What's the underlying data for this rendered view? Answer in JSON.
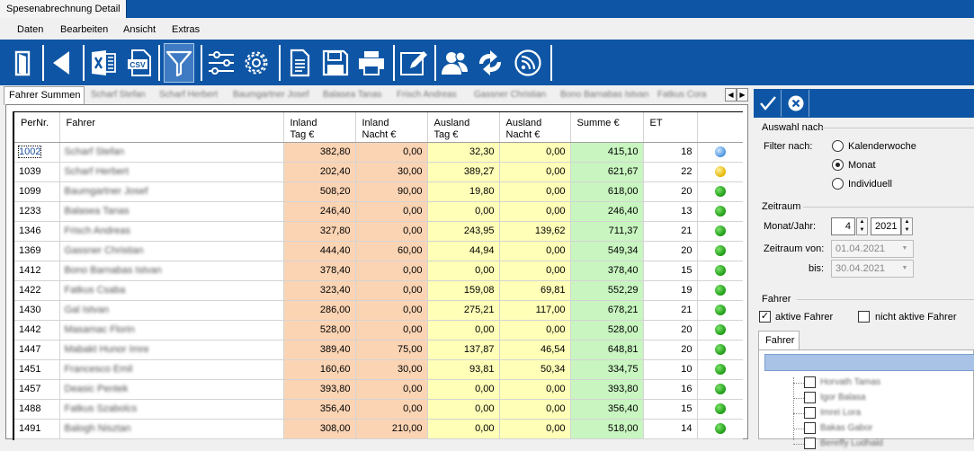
{
  "window": {
    "tab_title": "Spesenabrechnung Detail"
  },
  "menu": [
    "Daten",
    "Bearbeiten",
    "Ansicht",
    "Extras"
  ],
  "toolbar": {
    "icons": [
      "exit-door-icon",
      "back-arrow-icon",
      "excel-export-icon",
      "csv-export-icon",
      "filter-icon",
      "settings-sliders-icon",
      "gear-icon",
      "document-icon",
      "save-disk-icon",
      "print-icon",
      "edit-pencil-icon",
      "users-icon",
      "sync-arrows-icon",
      "rss-feed-icon"
    ],
    "csv_text": "CSV"
  },
  "tabs": {
    "active": "Fahrer Summen",
    "others": [
      "Scharf Stefan",
      "Scharf Herbert",
      "Baumgartner Josef",
      "Balasea Tanas",
      "Frisch Andreas",
      "Gassner Christian",
      "Bono Barnabas Istvan",
      "Fatkus Cora"
    ]
  },
  "grid": {
    "headers": {
      "pernr": "PerNr.",
      "fahrer": "Fahrer",
      "inland_tag": [
        "Inland",
        "Tag €"
      ],
      "inland_nacht": [
        "Inland",
        "Nacht €"
      ],
      "ausland_tag": [
        "Ausland",
        "Tag €"
      ],
      "ausland_nacht": [
        "Ausland",
        "Nacht €"
      ],
      "summe": "Summe €",
      "et": "ET"
    },
    "rows": [
      {
        "pernr": "1002",
        "fahrer": "Scharf Stefan",
        "it": "382,80",
        "in": "0,00",
        "at": "32,30",
        "an": "0,00",
        "sum": "415,10",
        "et": "18",
        "status": "blue"
      },
      {
        "pernr": "1039",
        "fahrer": "Scharf Herbert",
        "it": "202,40",
        "in": "30,00",
        "at": "389,27",
        "an": "0,00",
        "sum": "621,67",
        "et": "22",
        "status": "yellow"
      },
      {
        "pernr": "1099",
        "fahrer": "Baumgartner Josef",
        "it": "508,20",
        "in": "90,00",
        "at": "19,80",
        "an": "0,00",
        "sum": "618,00",
        "et": "20",
        "status": "green"
      },
      {
        "pernr": "1233",
        "fahrer": "Balasea Tanas",
        "it": "246,40",
        "in": "0,00",
        "at": "0,00",
        "an": "0,00",
        "sum": "246,40",
        "et": "13",
        "status": "green"
      },
      {
        "pernr": "1346",
        "fahrer": "Frisch Andreas",
        "it": "327,80",
        "in": "0,00",
        "at": "243,95",
        "an": "139,62",
        "sum": "711,37",
        "et": "21",
        "status": "green"
      },
      {
        "pernr": "1369",
        "fahrer": "Gassner Christian",
        "it": "444,40",
        "in": "60,00",
        "at": "44,94",
        "an": "0,00",
        "sum": "549,34",
        "et": "20",
        "status": "green"
      },
      {
        "pernr": "1412",
        "fahrer": "Bono Barnabas Istvan",
        "it": "378,40",
        "in": "0,00",
        "at": "0,00",
        "an": "0,00",
        "sum": "378,40",
        "et": "15",
        "status": "green"
      },
      {
        "pernr": "1422",
        "fahrer": "Fatkus Csaba",
        "it": "323,40",
        "in": "0,00",
        "at": "159,08",
        "an": "69,81",
        "sum": "552,29",
        "et": "19",
        "status": "green"
      },
      {
        "pernr": "1430",
        "fahrer": "Gal Istvan",
        "it": "286,00",
        "in": "0,00",
        "at": "275,21",
        "an": "117,00",
        "sum": "678,21",
        "et": "21",
        "status": "green"
      },
      {
        "pernr": "1442",
        "fahrer": "Masamac Florin",
        "it": "528,00",
        "in": "0,00",
        "at": "0,00",
        "an": "0,00",
        "sum": "528,00",
        "et": "20",
        "status": "green"
      },
      {
        "pernr": "1447",
        "fahrer": "Mabakt Hunor Imre",
        "it": "389,40",
        "in": "75,00",
        "at": "137,87",
        "an": "46,54",
        "sum": "648,81",
        "et": "20",
        "status": "green"
      },
      {
        "pernr": "1451",
        "fahrer": "Francesco Emil",
        "it": "160,60",
        "in": "30,00",
        "at": "93,81",
        "an": "50,34",
        "sum": "334,75",
        "et": "10",
        "status": "green"
      },
      {
        "pernr": "1457",
        "fahrer": "Deasic Pentek",
        "it": "393,80",
        "in": "0,00",
        "at": "0,00",
        "an": "0,00",
        "sum": "393,80",
        "et": "16",
        "status": "green"
      },
      {
        "pernr": "1488",
        "fahrer": "Fatkus Szabolcs",
        "it": "356,40",
        "in": "0,00",
        "at": "0,00",
        "an": "0,00",
        "sum": "356,40",
        "et": "15",
        "status": "green"
      },
      {
        "pernr": "1491",
        "fahrer": "Balogh Nisztan",
        "it": "308,00",
        "in": "210,00",
        "at": "0,00",
        "an": "0,00",
        "sum": "518,00",
        "et": "14",
        "status": "green"
      }
    ]
  },
  "right_panel": {
    "auswahl_title": "Auswahl nach",
    "filter_label": "Filter nach:",
    "radio_options": [
      "Kalenderwoche",
      "Monat",
      "Individuell"
    ],
    "radio_selected": "Monat",
    "zeitraum_title": "Zeitraum",
    "monat_jahr_label": "Monat/Jahr:",
    "month_value": "4",
    "year_value": "2021",
    "zeitraum_von_label": "Zeitraum von:",
    "von_value": "01.04.2021",
    "bis_label": "bis:",
    "bis_value": "30.04.2021",
    "fahrer_title": "Fahrer",
    "aktive_label": "aktive Fahrer",
    "aktive_checked": true,
    "nicht_aktive_label": "nicht aktive Fahrer",
    "nicht_aktive_checked": false,
    "fahrer_tab": "Fahrer",
    "tree_items": [
      "Horvath Tamas",
      "Igor Balasa",
      "Imrei Lora",
      "Bakas Gabor",
      "Bereffy Ludhald"
    ]
  },
  "colors": {
    "brand_blue": "#0e56a5",
    "inland": "#fbd4b4",
    "ausland": "#ffffb8",
    "summe": "#c8f5c0"
  }
}
